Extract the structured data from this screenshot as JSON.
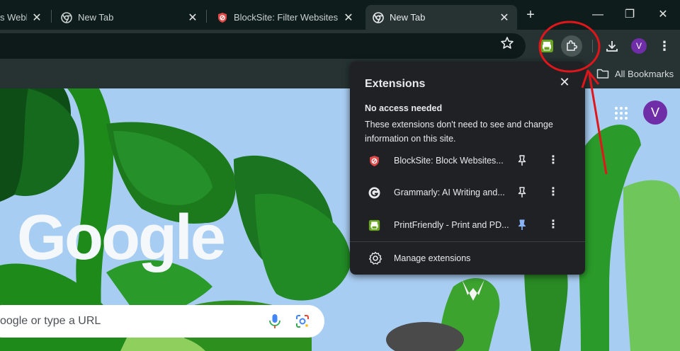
{
  "tabs": [
    {
      "title": "s Webl",
      "icon": "webpage-icon",
      "active": false
    },
    {
      "title": "New Tab",
      "icon": "chrome-icon",
      "active": false
    },
    {
      "title": "BlockSite: Filter Websites a",
      "icon": "blocksite-icon",
      "active": false
    },
    {
      "title": "New Tab",
      "icon": "chrome-icon",
      "active": true
    }
  ],
  "tab_close_glyph": "✕",
  "new_tab_glyph": "+",
  "window_controls": {
    "minimize": "—",
    "restore": "❐",
    "close": "✕"
  },
  "toolbar": {
    "profile_initial": "V",
    "more_glyph": "⋮"
  },
  "bookmarks": {
    "all_bookmarks": "All Bookmarks"
  },
  "page": {
    "logo": "Google",
    "search_placeholder": "oogle or type a URL",
    "avatar_initial": "V"
  },
  "extensions_panel": {
    "title": "Extensions",
    "close_glyph": "✕",
    "section_heading": "No access needed",
    "section_description": "These extensions don't need to see and change information on this site.",
    "items": [
      {
        "name": "BlockSite: Block Websites...",
        "icon": "blocksite-icon",
        "pinned": false
      },
      {
        "name": "Grammarly: AI Writing and...",
        "icon": "grammarly-icon",
        "pinned": false
      },
      {
        "name": "PrintFriendly - Print and PD...",
        "icon": "printfriendly-icon",
        "pinned": true
      }
    ],
    "more_glyph": "⋮",
    "manage_label": "Manage extensions"
  },
  "colors": {
    "accent_pin": "#8ab4f8",
    "annotation_red": "#e0161b",
    "avatar_purple": "#6f2da8"
  }
}
